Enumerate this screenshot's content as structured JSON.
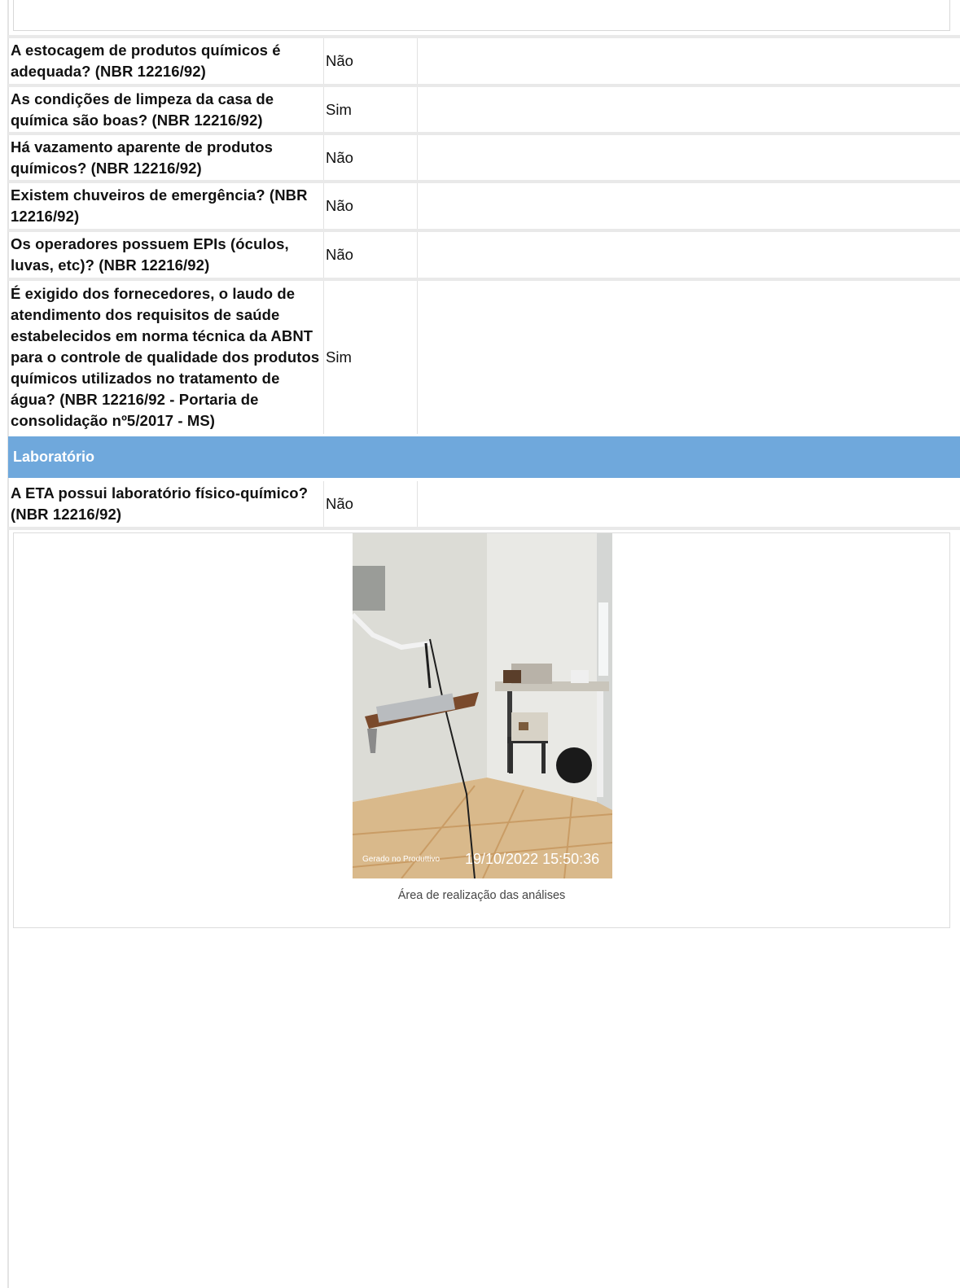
{
  "checklist_items": [
    {
      "question": "A estocagem de produtos químicos é adequada? (NBR 12216/92)",
      "answer": "Não"
    },
    {
      "question": "As condições de limpeza da casa de química são boas? (NBR 12216/92)",
      "answer": "Sim"
    },
    {
      "question": "Há vazamento aparente de produtos químicos? (NBR 12216/92)",
      "answer": "Não"
    },
    {
      "question": "Existem chuveiros de emergência? (NBR 12216/92)",
      "answer": "Não"
    },
    {
      "question": "Os operadores possuem EPIs (óculos, luvas, etc)? (NBR 12216/92)",
      "answer": "Não"
    },
    {
      "question": "É exigido dos fornecedores, o laudo de atendimento dos requisitos de saúde estabelecidos em norma técnica da ABNT para o controle de qualidade dos produtos químicos utilizados no tratamento de água? (NBR 12216/92 - Portaria de consolidação nº5/2017 - MS)",
      "answer": "Sim"
    }
  ],
  "section": {
    "title": "Laboratório"
  },
  "lab_item": {
    "question": "A ETA possui laboratório físico-químico? (NBR 12216/92)",
    "answer": "Não"
  },
  "photo": {
    "watermark": "Gerado no Produttivo",
    "timestamp": "19/10/2022 15:50:36",
    "caption": "Área de realização das análises"
  }
}
